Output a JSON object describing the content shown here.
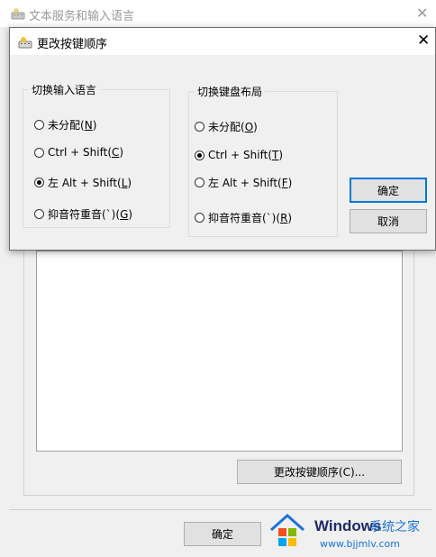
{
  "back_window": {
    "title": "文本服务和输入语言",
    "close_glyph": "✕",
    "change_sequence_button": "更改按键顺序(C)...",
    "ok_button": "确定"
  },
  "dialog": {
    "title": "更改按键顺序",
    "close_glyph": "✕",
    "switch_input_language": {
      "legend": "切换输入语言",
      "options": [
        {
          "text": "未分配",
          "accel": "N",
          "checked": false
        },
        {
          "text": "Ctrl + Shift",
          "accel": "C",
          "checked": false
        },
        {
          "text": "左 Alt + Shift",
          "accel": "L",
          "checked": true
        },
        {
          "text": "抑音符重音(`)",
          "accel": "G",
          "checked": false
        }
      ]
    },
    "switch_keyboard_layout": {
      "legend": "切换键盘布局",
      "options": [
        {
          "text": "未分配",
          "accel": "O",
          "checked": false
        },
        {
          "text": "Ctrl + Shift",
          "accel": "T",
          "checked": true
        },
        {
          "text": "左 Alt + Shift",
          "accel": "F",
          "checked": false
        },
        {
          "text": "抑音符重音(`)",
          "accel": "R",
          "checked": false
        }
      ]
    },
    "ok_button": "确定",
    "cancel_button": "取消"
  },
  "watermark": {
    "brand": "Windows",
    "subtitle": "系统之家",
    "url": "www.bjjmlv.com"
  },
  "icon_names": [
    "keyboard-settings-icon",
    "close-icon",
    "windows-logo-icon"
  ],
  "colors": {
    "focus_border": "#0078d7",
    "dialog_background": "#f0f0f0",
    "watermark_blue": "#1a73d9"
  }
}
